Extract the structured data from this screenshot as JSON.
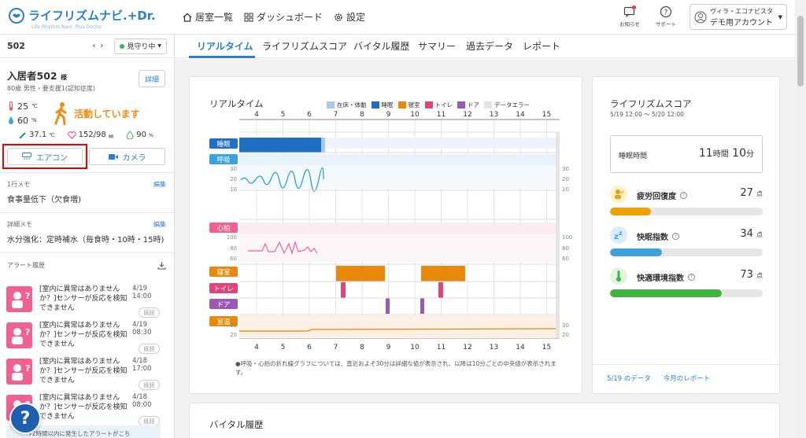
{
  "header": {
    "logo": "ライフリズムナビ.+Dr.",
    "logo_sub": "Life Rhythm Navi. Plus Doctor",
    "nav": [
      "居室一覧",
      "ダッシュボード",
      "設定"
    ],
    "notice_label": "お知らせ",
    "support_label": "サポート",
    "account_line1": "ヴィラ・エコナビスタ",
    "account_line2": "デモ用アカウント"
  },
  "sidebar": {
    "room": "502",
    "watch_status": "見守り中",
    "resident_name": "入居者502",
    "resident_suffix": "様",
    "resident_info": "80歳 男性・要支援1(認知症度)",
    "detail_button": "詳細",
    "temperature": "25",
    "temperature_unit": "℃",
    "humidity": "60",
    "humidity_unit": "%",
    "activity": "活動しています",
    "body_temp": "37.1",
    "body_temp_unit": "℃",
    "blood_pressure": "152/98",
    "blood_pressure_unit": "㎜",
    "spo2": "90",
    "spo2_unit": "%",
    "aircon_button": "エアコン",
    "camera_button": "カメラ",
    "memo1_label": "1行メモ",
    "memo1_edit": "編集",
    "memo1_value": "食事量低下（欠食増)",
    "memo2_label": "詳細メモ",
    "memo2_edit": "編集",
    "memo2_value": "水分強化：定時補水（毎食時・10時・15時)",
    "alerts_label": "アラート履歴",
    "alerts": [
      {
        "text": "[室内に異常はありませんか？]センサーが反応を検知できません",
        "date": "4/19 14:00",
        "status": "既読"
      },
      {
        "text": "[室内に異常はありませんか？]センサーが反応を検知できません",
        "date": "4/19 08:30",
        "status": "既読"
      },
      {
        "text": "[室内に異常はありませんか？]センサーが反応を検知できません",
        "date": "4/18 17:00",
        "status": "既読"
      },
      {
        "text": "[室内に異常はありませんか？]センサーが反応を検知できません",
        "date": "4/18 08:00",
        "status": "既読"
      }
    ],
    "alert_note": "72時間以内に発生したアラートがこち"
  },
  "tabs": [
    "リアルタイム",
    "ライフリズムスコア",
    "バイタル履歴",
    "サマリー",
    "過去データ",
    "レポート"
  ],
  "realtime": {
    "title": "リアルタイム",
    "legend": [
      {
        "label": "在床・体動",
        "color": "#a8c8ec"
      },
      {
        "label": "睡眠",
        "color": "#1f6fc5"
      },
      {
        "label": "寝室",
        "color": "#e8890c"
      },
      {
        "label": "トイレ",
        "color": "#e0447a"
      },
      {
        "label": "ドア",
        "color": "#9b59b6"
      },
      {
        "label": "データエラー",
        "color": "#e5e5e5"
      }
    ],
    "hours": [
      "4",
      "5",
      "6",
      "7",
      "8",
      "9",
      "10",
      "11",
      "12",
      "13",
      "14",
      "15"
    ],
    "rows": {
      "sleep": "睡眠",
      "resp": "呼吸",
      "heart": "心拍",
      "bedroom": "寝室",
      "toilet": "トイレ",
      "door": "ドア",
      "roomtemp": "室温"
    },
    "resp_ticks": [
      "30",
      "20",
      "10"
    ],
    "heart_ticks": [
      "100",
      "80",
      "60"
    ],
    "temp_ticks": [
      "30",
      "20"
    ],
    "note": "●呼吸・心拍の折れ線グラフについては、直近およそ30分は詳細な値が表示され、以降は10分ごとの中央値が表示されます。"
  },
  "score": {
    "title": "ライフリズムスコア",
    "period": "5/19 12:00 〜 5/20 12:00",
    "sleep_label": "睡眠時間",
    "sleep_hours": "11",
    "sleep_hours_unit": "時間",
    "sleep_minutes": "10",
    "sleep_minutes_unit": "分",
    "items": [
      {
        "label": "疲労回復度",
        "value": "27",
        "unit": "点",
        "percent": 27,
        "color": "#f0a000",
        "icon_bg": "#fdf1cf"
      },
      {
        "label": "快眠指数",
        "value": "34",
        "unit": "点",
        "percent": 34,
        "color": "#3ba2dc",
        "icon_bg": "#dcecf8"
      },
      {
        "label": "快適環境指数",
        "value": "73",
        "unit": "点",
        "percent": 73,
        "color": "#3fb53f",
        "icon_bg": "#e2f3e0"
      }
    ],
    "link1": "5/19 のデータ",
    "link2": "今月のレポート"
  },
  "vital": {
    "title": "バイタル履歴"
  },
  "colors": {
    "accent": "#2a7fd1",
    "warning": "#f08c18",
    "alert": "#f06090"
  }
}
